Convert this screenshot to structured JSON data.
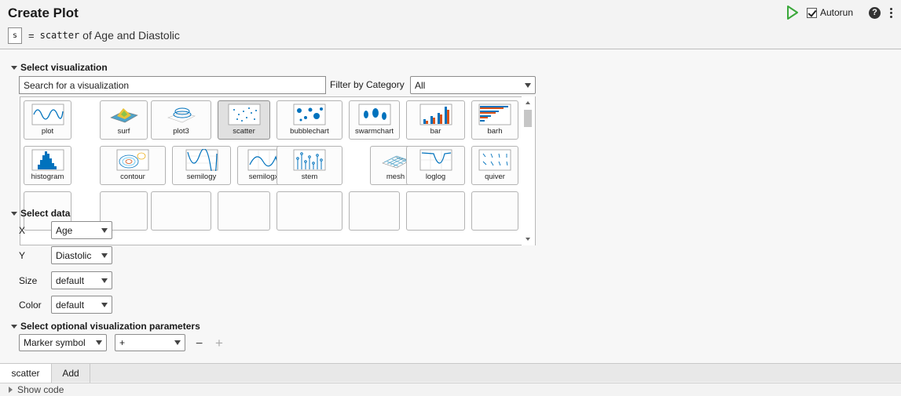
{
  "header": {
    "title": "Create Plot",
    "variable": "s",
    "equals": "=",
    "function": "scatter",
    "description": "of Age and Diastolic",
    "autorun_label": "Autorun",
    "autorun_checked": true,
    "help_symbol": "?"
  },
  "visualization": {
    "section_title": "Select visualization",
    "search_value": "Search for a visualization",
    "filter_label": "Filter by Category",
    "filter_value": "All",
    "selected": "scatter",
    "tiles": [
      {
        "label": "plot",
        "icon": "plot-icon"
      },
      {
        "label": "surf",
        "icon": "surf-icon"
      },
      {
        "label": "plot3",
        "icon": "plot3-icon"
      },
      {
        "label": "scatter",
        "icon": "scatter-icon"
      },
      {
        "label": "bubblechart",
        "icon": "bubblechart-icon"
      },
      {
        "label": "swarmchart",
        "icon": "swarmchart-icon"
      },
      {
        "label": "bar",
        "icon": "bar-icon"
      },
      {
        "label": "barh",
        "icon": "barh-icon"
      },
      {
        "label": "histogram",
        "icon": "histogram-icon"
      },
      {
        "label": "contour",
        "icon": "contour-icon"
      },
      {
        "label": "semilogy",
        "icon": "semilogy-icon"
      },
      {
        "label": "semilogx",
        "icon": "semilogx-icon"
      },
      {
        "label": "stem",
        "icon": "stem-icon"
      },
      {
        "label": "mesh",
        "icon": "mesh-icon"
      },
      {
        "label": "loglog",
        "icon": "loglog-icon"
      },
      {
        "label": "quiver",
        "icon": "quiver-icon"
      }
    ]
  },
  "data": {
    "section_title": "Select data",
    "fields": [
      {
        "label": "X",
        "value": "Age"
      },
      {
        "label": "Y",
        "value": "Diastolic"
      },
      {
        "label": "Size",
        "value": "default"
      },
      {
        "label": "Color",
        "value": "default"
      }
    ]
  },
  "params": {
    "section_title": "Select optional visualization parameters",
    "param_name": "Marker symbol",
    "param_value": "+",
    "remove_symbol": "−",
    "add_symbol": "+"
  },
  "tabs": [
    {
      "label": "scatter",
      "active": true
    },
    {
      "label": "Add",
      "active": false
    }
  ],
  "footer": {
    "show_code_label": "Show code"
  },
  "colors": {
    "accent_blue": "#0072BD",
    "accent_orange": "#D95319",
    "run_green": "#3aa83a"
  }
}
